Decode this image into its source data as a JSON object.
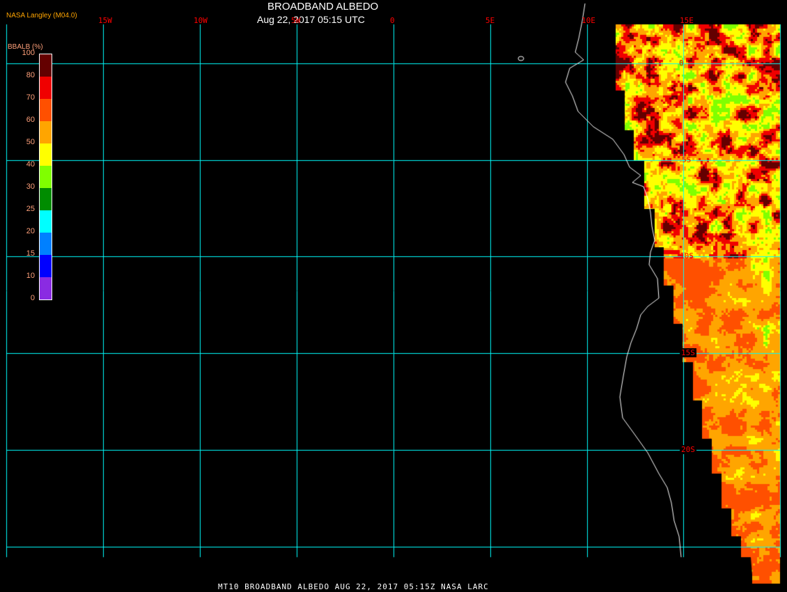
{
  "header": {
    "title": "BROADBAND ALBEDO",
    "datetime": "Aug 22, 2017 05:15 UTC",
    "source": "NASA Langley (M04.0)"
  },
  "longitude_labels": [
    "15W",
    "10W",
    "5W",
    "0",
    "5E",
    "10E",
    "15E"
  ],
  "latitude_labels": [
    "0",
    "5S",
    "10S",
    "15S",
    "20S"
  ],
  "colorbar": {
    "title": "BBALB (%)",
    "ticks": [
      "0",
      "10",
      "15",
      "20",
      "25",
      "30",
      "40",
      "50",
      "60",
      "70",
      "80",
      "100"
    ],
    "colors": [
      "#8a2be2",
      "#0000ff",
      "#0080ff",
      "#00ffff",
      "#008c00",
      "#80ff00",
      "#ffff00",
      "#ffa500",
      "#ff5000",
      "#f00000",
      "#640000"
    ]
  },
  "grid_color": "#00ffff",
  "coastline_color": "#ffffff",
  "footer": "MT10  BROADBAND ALBEDO   AUG 22, 2017 05:15Z   NASA LARC"
}
